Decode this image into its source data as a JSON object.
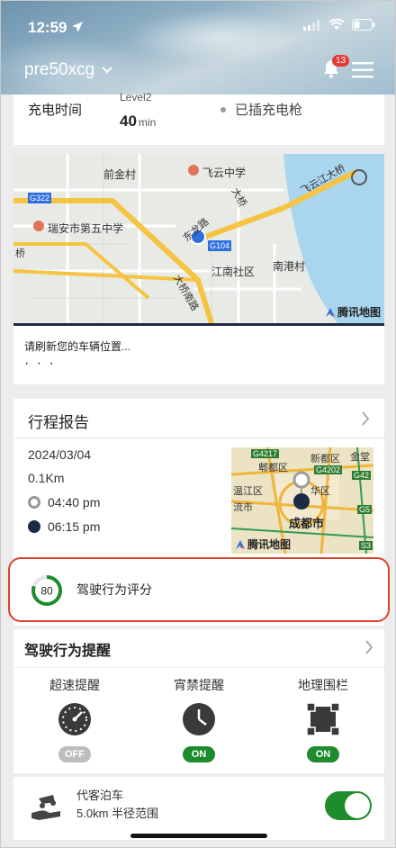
{
  "status_bar": {
    "time": "12:59"
  },
  "header": {
    "vehicle_name": "pre50xcg",
    "notification_count": "13"
  },
  "charge": {
    "label": "充电时间",
    "level": "Level2",
    "value": "40",
    "unit": "min",
    "plug_status": "已插充电枪"
  },
  "map": {
    "labels": {
      "l1": "前金村",
      "l2": "飞云中学",
      "l3": "飞云江大桥",
      "l4": "G322",
      "l5": "大桥",
      "l6": "瑞安市第五中学",
      "l7": "东龙路",
      "l8": "G104",
      "l9": "江南社区",
      "l10": "南港村",
      "l11": "大桥南路",
      "l12": "桥"
    },
    "brand": "腾讯地图",
    "refresh_text": "请刷新您的车辆位置...",
    "dots": "· · ·"
  },
  "trip_report": {
    "title": "行程报告",
    "date": "2024/03/04",
    "distance": "0.1Km",
    "start_time": "04:40 pm",
    "end_time": "06:15 pm",
    "mini_map": {
      "labels": {
        "m1": "G4217",
        "m2": "新都区",
        "m3": "郫都区",
        "m4": "G4202",
        "m5": "华区",
        "m6": "温江区",
        "m7": "成都市",
        "m8": "G42",
        "m9": "G5",
        "m10": "S3",
        "m11": "流市",
        "m12": "金堂"
      },
      "brand": "腾讯地图"
    }
  },
  "driving_score": {
    "score": "80",
    "label": "驾驶行为评分",
    "score_fraction": 0.8
  },
  "driving_alerts": {
    "title": "驾驶行为提醒",
    "items": [
      {
        "label": "超速提醒",
        "icon": "speedometer-icon",
        "state": "OFF"
      },
      {
        "label": "宵禁提醒",
        "icon": "clock-icon",
        "state": "ON"
      },
      {
        "label": "地理围栏",
        "icon": "geofence-icon",
        "state": "ON"
      }
    ]
  },
  "valet": {
    "title": "代客泊车",
    "subtitle": "5.0km 半径范围",
    "enabled": true
  },
  "colors": {
    "accent_green": "#1e8b2c",
    "highlight_red": "#d9442f",
    "dark_navy": "#1c2b45"
  }
}
